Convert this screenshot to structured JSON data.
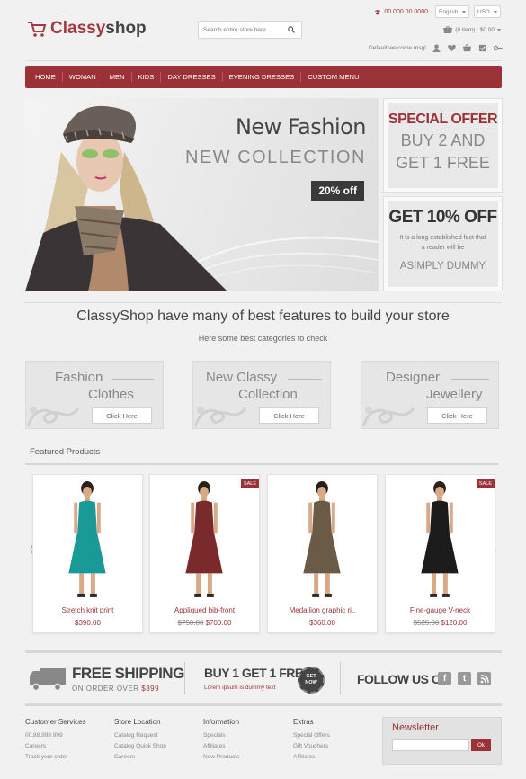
{
  "header": {
    "logo_part1": "Classy",
    "logo_part2": "shop",
    "search_placeholder": "Search entire store here...",
    "phone": "00 000 00 0000",
    "language": "English",
    "currency": "USD",
    "cart_summary": "(0 item) : $0.00",
    "welcome": "Default welcome msg!"
  },
  "nav": [
    "HOME",
    "WOMAN",
    "MEN",
    "KIDS",
    "DAY DRESSES",
    "EVENING DRESSES",
    "CUSTOM MENU"
  ],
  "banner": {
    "title": "New Fashion",
    "subtitle": "NEW COLLECTION",
    "badge": "20% off"
  },
  "promo1": {
    "heading": "SPECIAL OFFER",
    "line1": "BUY 2 AND",
    "line2": "GET 1 FREE"
  },
  "promo2": {
    "heading": "GET 10% OFF",
    "text": "It is a long established fact that a reader will be",
    "footer": "ASIMPLY DUMMY"
  },
  "features": {
    "title": "ClassyShop have many of best features to build your store",
    "subtitle": "Here some best categories to check"
  },
  "categories": [
    {
      "line1": "Fashion",
      "line2": "Clothes",
      "button": "Click Here"
    },
    {
      "line1": "New Classy",
      "line2": "Collection",
      "button": "Click Here"
    },
    {
      "line1": "Designer",
      "line2": "Jewellery",
      "button": "Click Here"
    }
  ],
  "featured_title": "Featured Products",
  "products": [
    {
      "name": "Stretch knit print",
      "old_price": "",
      "price": "$390.00",
      "sale": "",
      "dress_color": "#1a9a96"
    },
    {
      "name": "Appliqued bib-front",
      "old_price": "$750.00",
      "price": "$700.00",
      "sale": "SALE",
      "dress_color": "#7a2a2a"
    },
    {
      "name": "Medallion graphic ri..",
      "old_price": "",
      "price": "$360.00",
      "sale": "",
      "dress_color": "#6b5a45"
    },
    {
      "name": "Fine-gauge V-neck",
      "old_price": "$525.00",
      "price": "$120.00",
      "sale": "SALE",
      "dress_color": "#1c1c1c"
    }
  ],
  "strip": {
    "shipping_title": "FREE SHIPPING",
    "shipping_sub_prefix": "ON ORDER OVER",
    "shipping_amount": "$399",
    "buy_title": "BUY 1 GET 1 FREE",
    "buy_sub": "Lorem ipsum is dummy text",
    "get_now_1": "GET",
    "get_now_2": "NOW",
    "follow": "FOLLOW US ON"
  },
  "footer": {
    "columns": [
      {
        "title": "Customer Services",
        "links": [
          "00.88.999.999",
          "Careers",
          "Track your order"
        ]
      },
      {
        "title": "Store Location",
        "links": [
          "Catalog Request",
          "Catalog Quick Shop",
          "Careers"
        ]
      },
      {
        "title": "Information",
        "links": [
          "Specials",
          "Affiliates",
          "New Products"
        ]
      },
      {
        "title": "Extras",
        "links": [
          "Special Offers",
          "Gift Vouchers",
          "Affiliates"
        ]
      }
    ],
    "newsletter_title": "Newsletter",
    "newsletter_button": "Ok"
  },
  "colors": {
    "brand": "#9a3238",
    "dark": "#444444"
  }
}
